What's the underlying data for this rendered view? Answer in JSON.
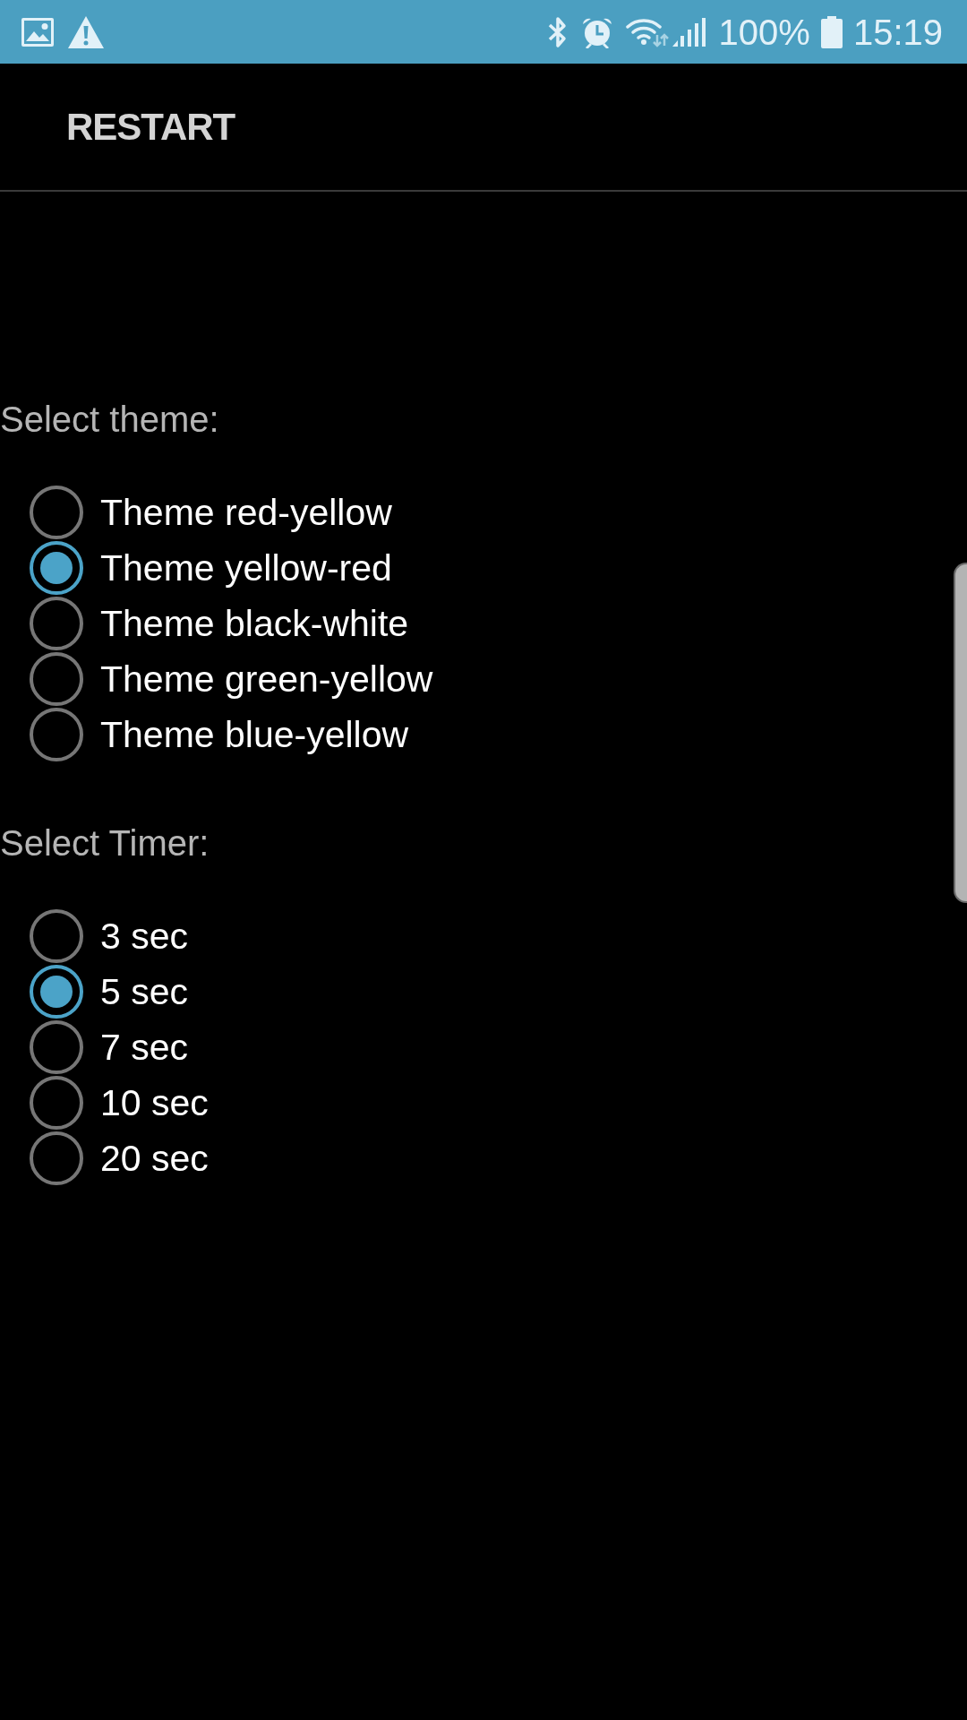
{
  "status_bar": {
    "battery": "100%",
    "time": "15:19"
  },
  "toolbar": {
    "action": "RESTART"
  },
  "sections": [
    {
      "label": "Select theme:",
      "options": [
        {
          "label": "Theme red-yellow",
          "selected": false
        },
        {
          "label": "Theme yellow-red",
          "selected": true
        },
        {
          "label": "Theme black-white",
          "selected": false
        },
        {
          "label": "Theme green-yellow",
          "selected": false
        },
        {
          "label": "Theme blue-yellow",
          "selected": false
        }
      ]
    },
    {
      "label": "Select Timer:",
      "options": [
        {
          "label": "3 sec",
          "selected": false
        },
        {
          "label": "5 sec",
          "selected": true
        },
        {
          "label": "7 sec",
          "selected": false
        },
        {
          "label": "10 sec",
          "selected": false
        },
        {
          "label": "20 sec",
          "selected": false
        }
      ]
    }
  ]
}
